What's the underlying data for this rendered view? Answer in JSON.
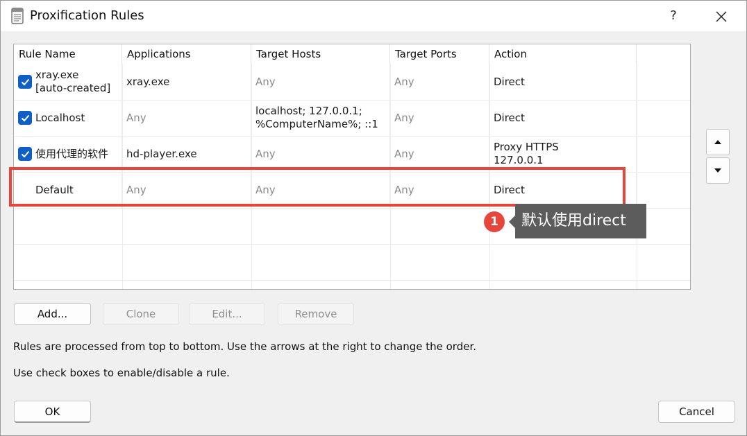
{
  "window": {
    "title": "Proxification Rules",
    "help_label": "?"
  },
  "table": {
    "columns": [
      "Rule Name",
      "Applications",
      "Target Hosts",
      "Target Ports",
      "Action"
    ],
    "rows": [
      {
        "checked": true,
        "name_lines": [
          "xray.exe",
          "[auto-created]"
        ],
        "applications": "xray.exe",
        "target_hosts": [
          "Any"
        ],
        "target_ports": "Any",
        "action": [
          "Direct"
        ]
      },
      {
        "checked": true,
        "name_lines": [
          "Localhost"
        ],
        "applications": "Any",
        "target_hosts": [
          "localhost; 127.0.0.1;",
          "%ComputerName%; ::1"
        ],
        "target_ports": "Any",
        "action": [
          "Direct"
        ]
      },
      {
        "checked": true,
        "name_lines": [
          "使用代理的软件"
        ],
        "applications": "hd-player.exe",
        "target_hosts": [
          "Any"
        ],
        "target_ports": "Any",
        "action": [
          "Proxy HTTPS",
          "127.0.0.1"
        ]
      },
      {
        "checked": false,
        "name_lines": [
          "Default"
        ],
        "applications": "Any",
        "target_hosts": [
          "Any"
        ],
        "target_ports": "Any",
        "action": [
          "Direct"
        ]
      }
    ]
  },
  "annotation": {
    "badge": "1",
    "text": "默认使用direct",
    "color": "#e8453c"
  },
  "buttons": {
    "add": "Add...",
    "clone": "Clone",
    "edit": "Edit...",
    "remove": "Remove",
    "ok": "OK",
    "cancel": "Cancel"
  },
  "info": {
    "line1": "Rules are processed from top to bottom. Use the arrows at the right to change the order.",
    "line2": "Use check boxes to enable/disable a rule."
  },
  "icons": {
    "move_up": "arrow-up-icon",
    "move_down": "arrow-down-icon",
    "close": "close-icon",
    "app": "document-icon",
    "check": "checkmark-icon"
  },
  "colors": {
    "checkbox": "#0f5fc6",
    "tooltip_bg": "#5c5c5c"
  }
}
